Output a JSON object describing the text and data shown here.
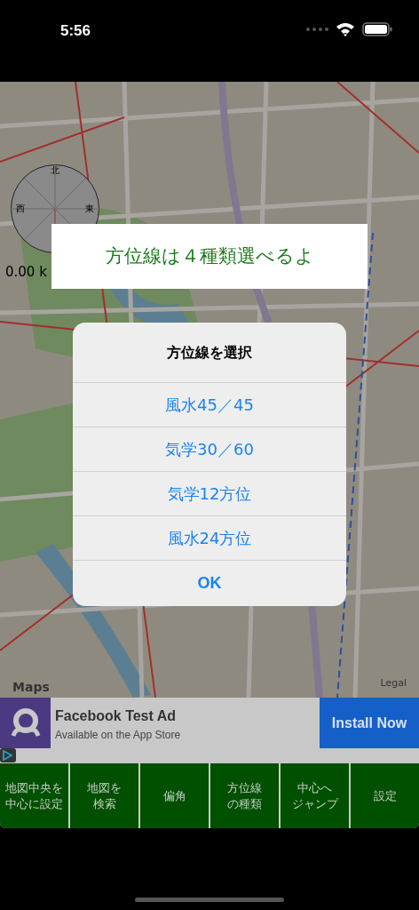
{
  "status_bar": {
    "time": "5:56"
  },
  "map": {
    "compass": {
      "labels": [
        "北",
        "東",
        "西"
      ]
    },
    "distance": "0.00 k",
    "attribution": "Maps",
    "legal": "Legal"
  },
  "hint_banner": "方位線は４種類選べるよ",
  "dialog": {
    "title": "方位線を選択",
    "options": [
      "風水45／45",
      "気学30／60",
      "気学12方位",
      "風水24方位"
    ],
    "ok": "OK"
  },
  "ad": {
    "title": "Facebook Test Ad",
    "subtitle": "Available on the App Store",
    "button": "Install Now"
  },
  "toolbar": [
    [
      "地図中央を",
      "中心に設定"
    ],
    [
      "地図を",
      "検索"
    ],
    [
      "偏角"
    ],
    [
      "方位線",
      "の種類"
    ],
    [
      "中心へ",
      "ジャンプ"
    ],
    [
      "設定"
    ]
  ]
}
